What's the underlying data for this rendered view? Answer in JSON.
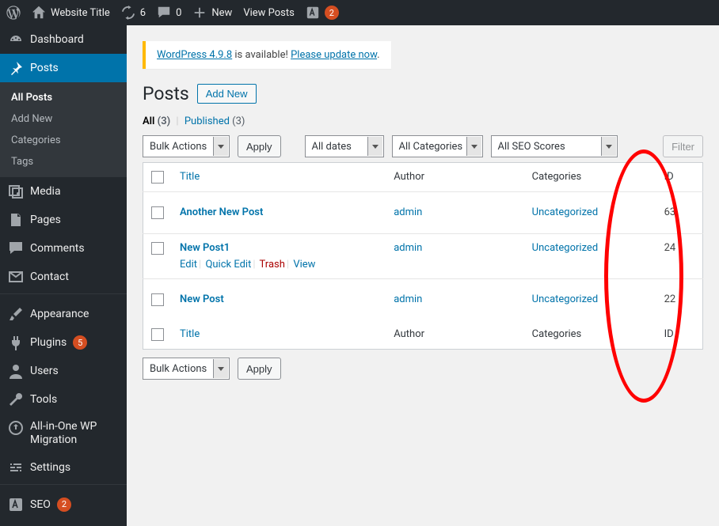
{
  "adminbar": {
    "site_title": "Website Title",
    "updates_count": "6",
    "comments_count": "0",
    "new_label": "New",
    "view_posts_label": "View Posts",
    "seo_badge": "2"
  },
  "sidebar": {
    "dashboard": "Dashboard",
    "posts": "Posts",
    "posts_sub": {
      "all_posts": "All Posts",
      "add_new": "Add New",
      "categories": "Categories",
      "tags": "Tags"
    },
    "media": "Media",
    "pages": "Pages",
    "comments": "Comments",
    "contact": "Contact",
    "appearance": "Appearance",
    "plugins": "Plugins",
    "plugins_badge": "5",
    "users": "Users",
    "tools": "Tools",
    "aio": "All-in-One WP Migration",
    "settings": "Settings",
    "seo": "SEO",
    "seo_badge": "2"
  },
  "notice": {
    "link1": "WordPress 4.9.8",
    "mid": " is available! ",
    "link2": "Please update now",
    "tail": "."
  },
  "page": {
    "title": "Posts",
    "add_new": "Add New"
  },
  "subsubsub": {
    "all": "All",
    "all_count": "(3)",
    "published": "Published",
    "published_count": "(3)"
  },
  "filters": {
    "bulk": "Bulk Actions",
    "apply": "Apply",
    "dates": "All dates",
    "categories": "All Categories",
    "seo": "All SEO Scores",
    "filter": "Filter"
  },
  "columns": {
    "title": "Title",
    "author": "Author",
    "categories": "Categories",
    "id": "ID"
  },
  "row_actions": {
    "edit": "Edit",
    "quick_edit": "Quick Edit",
    "trash": "Trash",
    "view": "View"
  },
  "posts": [
    {
      "title": "Another New Post",
      "author": "admin",
      "category": "Uncategorized",
      "id": "63",
      "show_actions": false
    },
    {
      "title": "New Post1",
      "author": "admin",
      "category": "Uncategorized",
      "id": "24",
      "show_actions": true
    },
    {
      "title": "New Post",
      "author": "admin",
      "category": "Uncategorized",
      "id": "22",
      "show_actions": false
    }
  ]
}
